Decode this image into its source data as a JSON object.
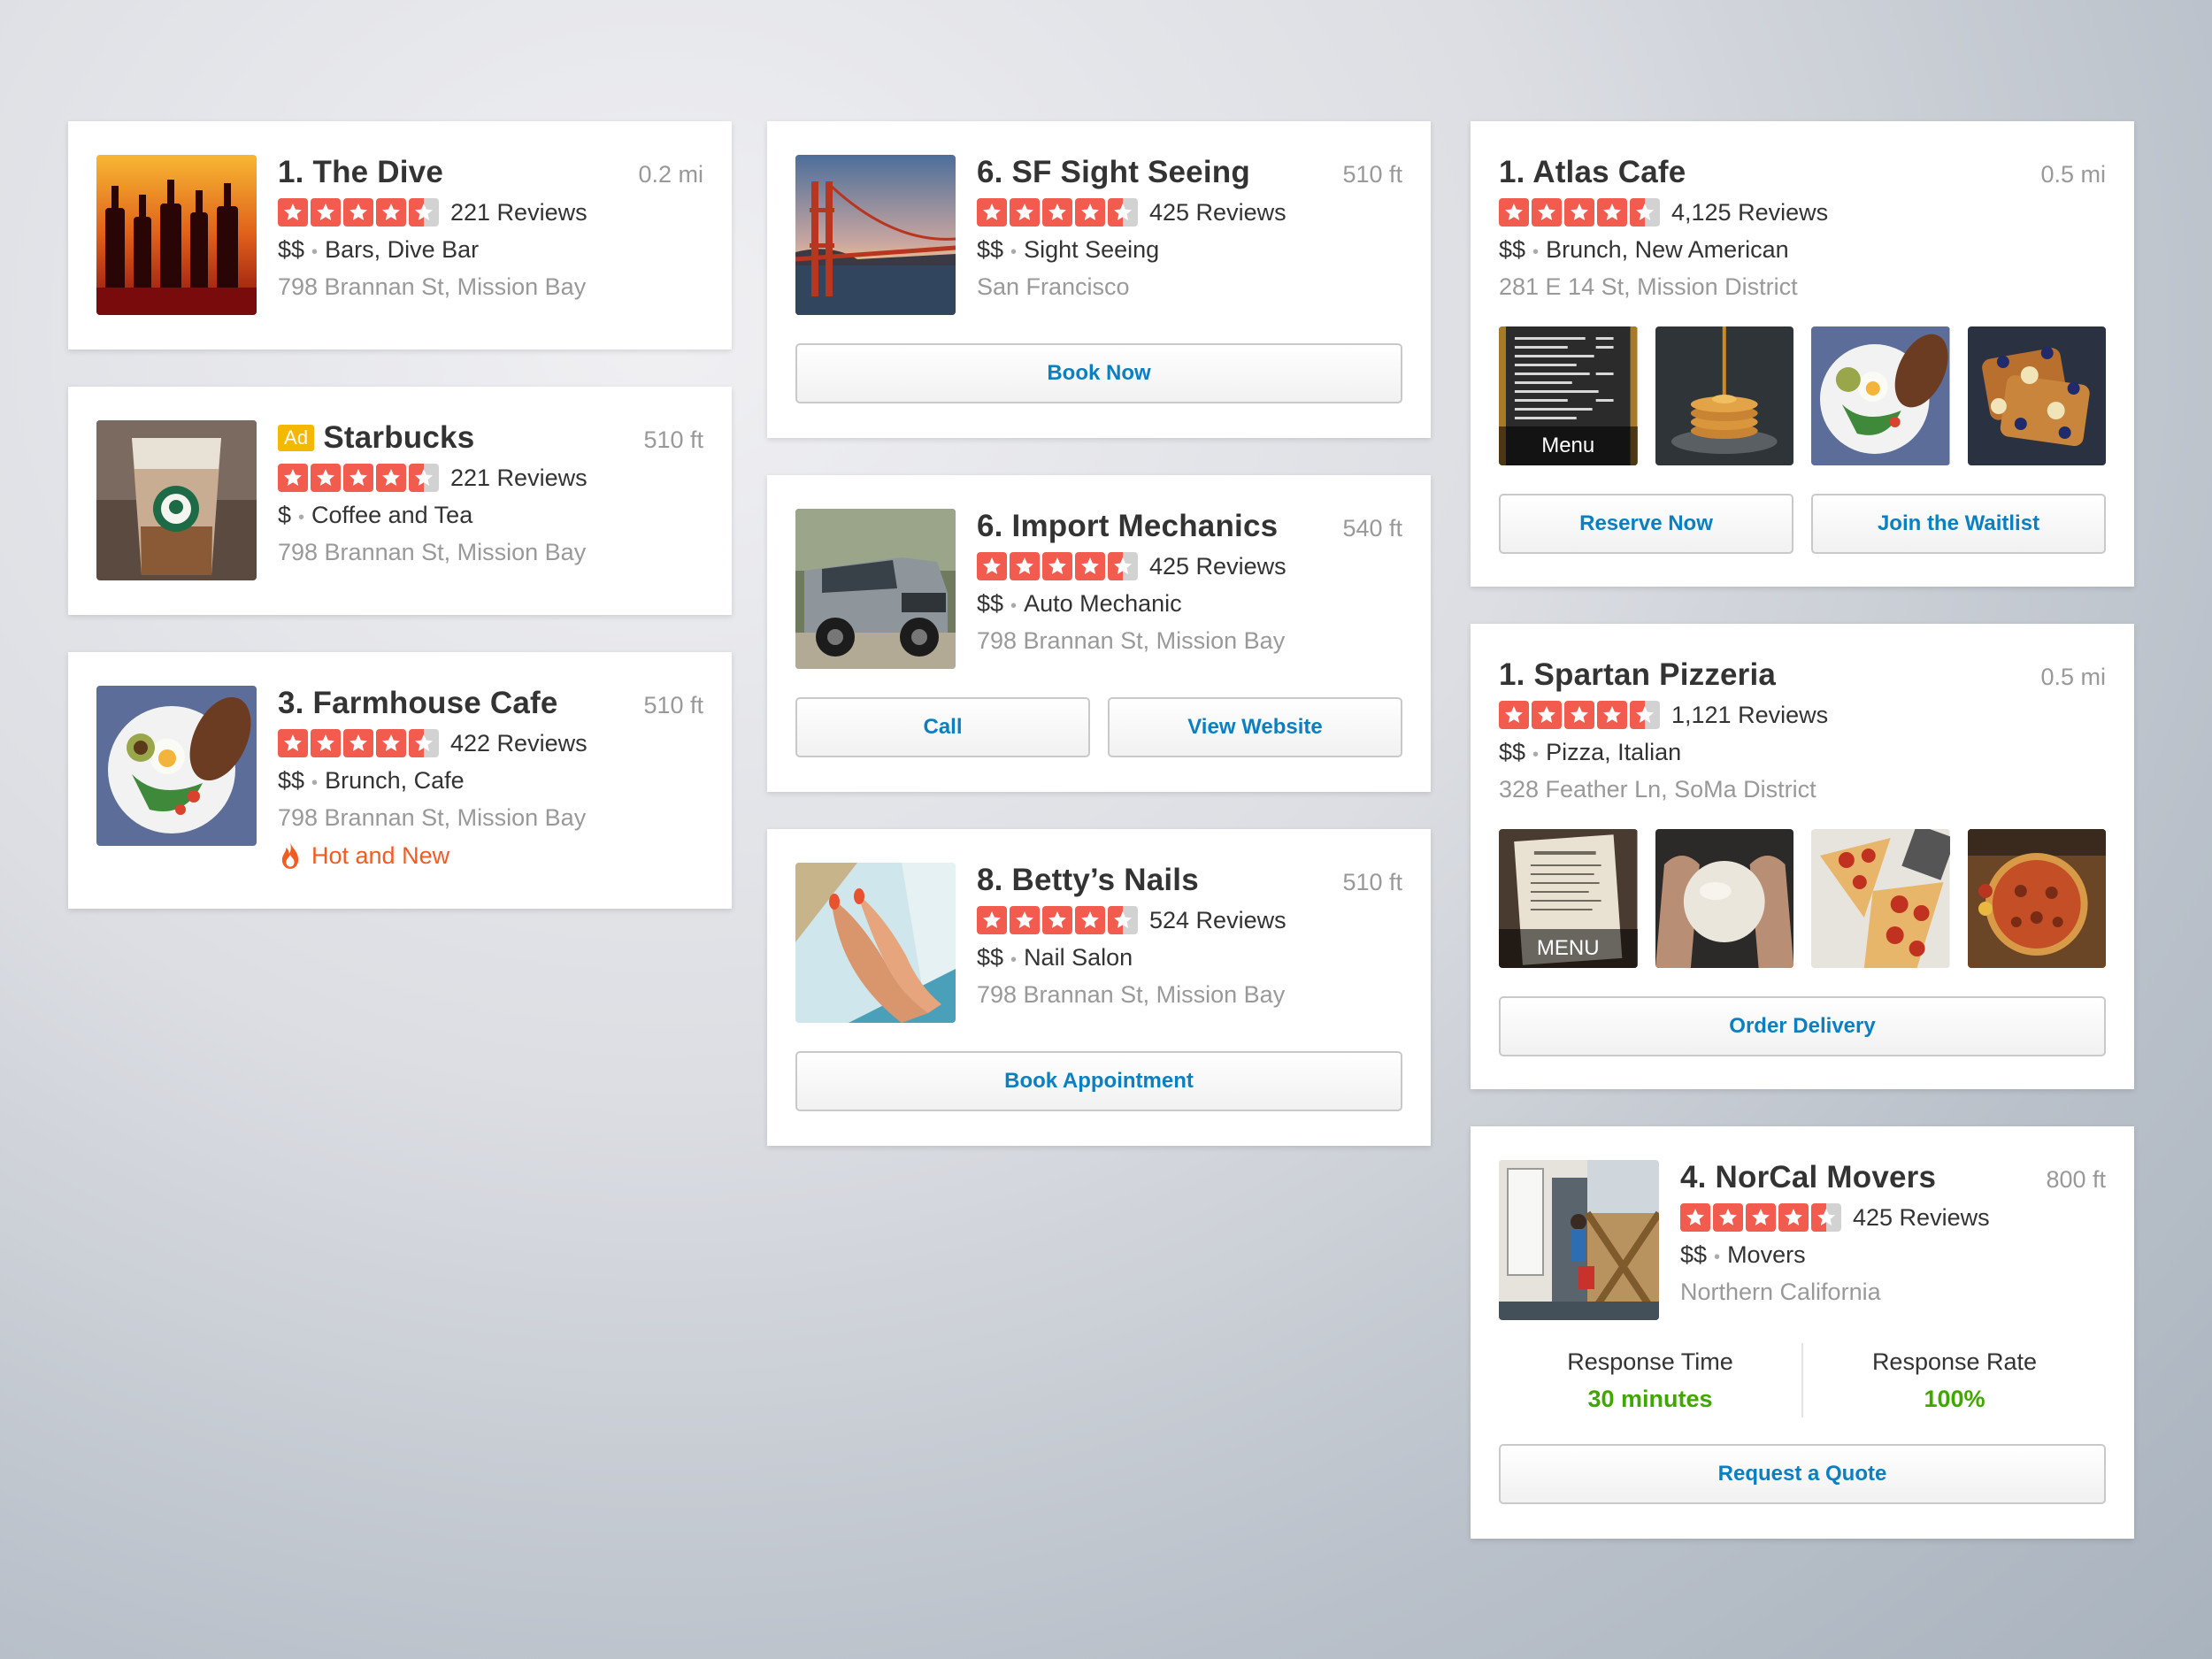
{
  "star_icon": "star-icon",
  "colors": {
    "star_red": "#f15c4f",
    "star_empty": "#d2d2d2",
    "link_blue": "#0a7fc2",
    "hot_orange": "#f15c22",
    "response_green": "#41a700",
    "ad_yellow": "#f5b800"
  },
  "cards": {
    "dive": {
      "title": "1. The Dive",
      "distance": "0.2 mi",
      "stars": 4.5,
      "reviews": "221 Reviews",
      "price": "$$",
      "category": "Bars, Dive Bar",
      "address": "798 Brannan St, Mission Bay",
      "image": "bar-bottles-photo"
    },
    "starbucks": {
      "ad": "Ad",
      "title": "Starbucks",
      "distance": "510 ft",
      "stars": 4.5,
      "reviews": "221 Reviews",
      "price": "$",
      "category": "Coffee and Tea",
      "address": "798 Brannan St, Mission Bay",
      "image": "iced-coffee-photo"
    },
    "farmhouse": {
      "title": "3. Farmhouse Cafe",
      "distance": "510 ft",
      "stars": 4.5,
      "reviews": "422 Reviews",
      "price": "$$",
      "category": "Brunch, Cafe",
      "address": "798 Brannan St, Mission Bay",
      "badge": "Hot and New",
      "image": "brunch-plate-photo"
    },
    "sf": {
      "title": "6. SF Sight Seeing",
      "distance": "510 ft",
      "stars": 4.5,
      "reviews": "425 Reviews",
      "price": "$$",
      "category": "Sight Seeing",
      "address": "San Francisco",
      "button": "Book Now",
      "image": "golden-gate-photo"
    },
    "mechanics": {
      "title": "6. Import Mechanics",
      "distance": "540 ft",
      "stars": 4.5,
      "reviews": "425 Reviews",
      "price": "$$",
      "category": "Auto Mechanic",
      "address": "798 Brannan St, Mission Bay",
      "button1": "Call",
      "button2": "View Website",
      "image": "suv-photo"
    },
    "nails": {
      "title": "8. Betty’s Nails",
      "distance": "510 ft",
      "stars": 4.5,
      "reviews": "524 Reviews",
      "price": "$$",
      "category": "Nail Salon",
      "address": "798 Brannan St, Mission Bay",
      "button": "Book Appointment",
      "image": "manicure-photo"
    },
    "atlas": {
      "title": "1. Atlas Cafe",
      "distance": "0.5 mi",
      "stars": 4.5,
      "reviews": "4,125 Reviews",
      "price": "$$",
      "category": "Brunch, New American",
      "address": "281 E 14 St, Mission District",
      "menu_label": "Menu",
      "button1": "Reserve Now",
      "button2": "Join the Waitlist",
      "photos": [
        "menu-board-photo",
        "pancakes-photo",
        "brunch-plate-photo",
        "french-toast-photo"
      ]
    },
    "spartan": {
      "title": "1. Spartan Pizzeria",
      "distance": "0.5 mi",
      "stars": 4.5,
      "reviews": "1,121 Reviews",
      "price": "$$",
      "category": "Pizza, Italian",
      "address": "328 Feather Ln, SoMa District",
      "menu_label": "MENU",
      "button": "Order Delivery",
      "photos": [
        "menu-card-photo",
        "dough-photo",
        "pizza-slices-photo",
        "pizza-board-photo"
      ]
    },
    "norcal": {
      "title": "4. NorCal Movers",
      "distance": "800 ft",
      "stars": 4.5,
      "reviews": "425 Reviews",
      "price": "$$",
      "category": "Movers",
      "address": "Northern California",
      "response_time_label": "Response Time",
      "response_time": "30 minutes",
      "response_rate_label": "Response Rate",
      "response_rate": "100%",
      "button": "Request a Quote",
      "image": "moving-truck-photo"
    }
  }
}
